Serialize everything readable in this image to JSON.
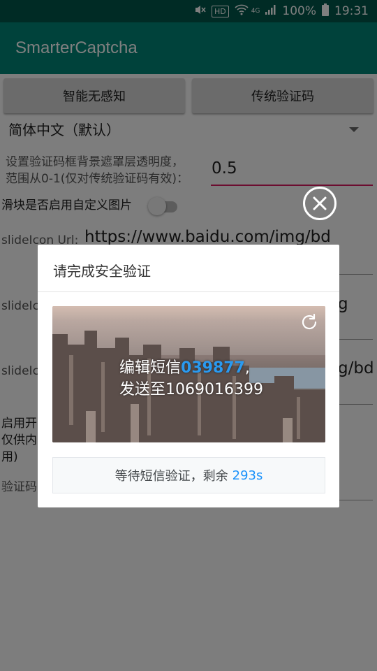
{
  "status_bar": {
    "hd": "HD",
    "network": "4G",
    "battery": "100%",
    "time": "19:31"
  },
  "app": {
    "title": "SmarterCaptcha"
  },
  "buttons": {
    "smart": "智能无感知",
    "traditional": "传统验证码"
  },
  "language": {
    "selected": "简体中文（默认）"
  },
  "opacity": {
    "label_line1": "设置验证码框背景遮罩层透明度，",
    "label_line2": "范围从0-1(仅对传统验证码有效)：",
    "value": "0.5"
  },
  "slider_custom": {
    "label": "滑块是否启用自定义图片"
  },
  "slide_icon": {
    "label": "slideIcon Url:",
    "value": "https://www.baidu.com/img/bd"
  },
  "slide_bg1": {
    "label": "slideIc",
    "suffix": "g"
  },
  "slide_bg2": {
    "label": "slideIc",
    "suffix": "g/bd"
  },
  "enable_section": {
    "line1": "启用开",
    "line2": "仅供内",
    "line3": "用)"
  },
  "captcha_code": {
    "label": "验证码"
  },
  "dialog": {
    "title": "请完成安全验证",
    "sms_prefix": "编辑短信",
    "sms_code": "039877",
    "sms_comma": ",",
    "sms_line2": "发送至1069016399",
    "waiting_text": "等待短信验证，剩余",
    "countdown": "293s"
  },
  "colors": {
    "primary": "#008577",
    "primary_dark": "#00574b",
    "accent": "#d81b60",
    "countdown": "#1991fa"
  }
}
